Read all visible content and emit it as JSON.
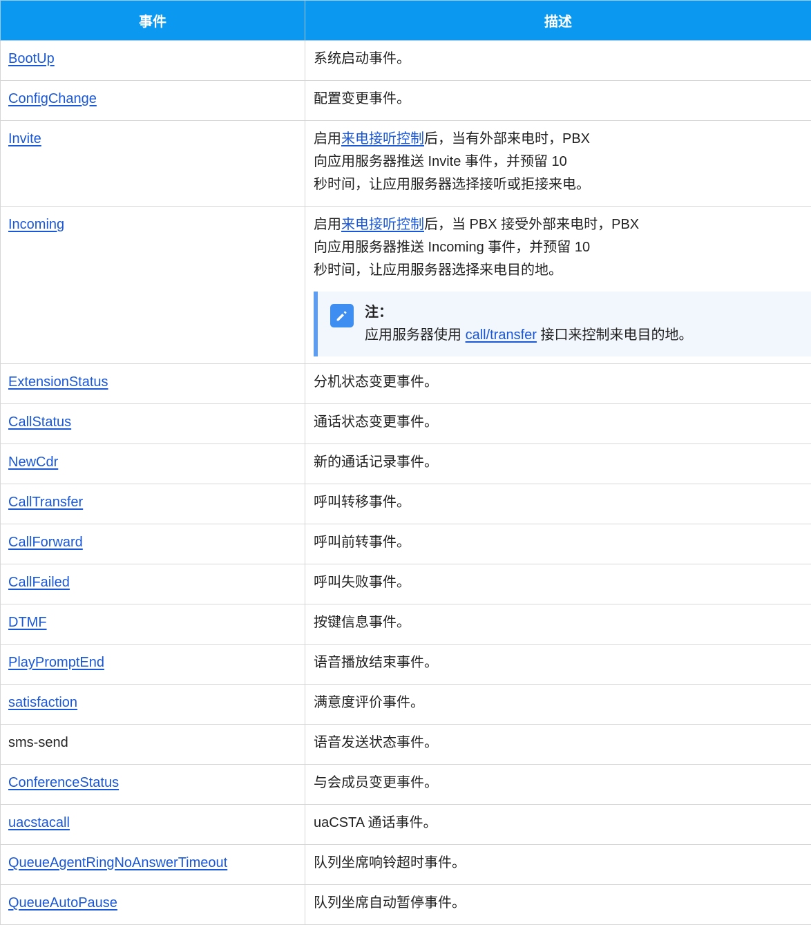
{
  "table": {
    "headers": [
      "事件",
      "描述"
    ],
    "rows": [
      {
        "event": "BootUp",
        "desc": "系统启动事件。"
      },
      {
        "event": "ConfigChange",
        "desc": "配置变更事件。"
      },
      {
        "event": "Invite",
        "desc_lines": [
          {
            "pre": "启用",
            "link": "来电接听控制",
            "post": "后，当有外部来电时，PBX"
          },
          "向应用服务器推送 Invite 事件，并预留 10",
          "秒时间，让应用服务器选择接听或拒接来电。"
        ]
      },
      {
        "event": "Incoming",
        "desc_lines": [
          {
            "pre": "启用",
            "link": "来电接听控制",
            "post": "后，当 PBX 接受外部来电时，PBX"
          },
          "向应用服务器推送 Incoming 事件，并预留 10",
          "秒时间，让应用服务器选择来电目的地。"
        ],
        "note": {
          "icon": "edit-icon",
          "title": "注：",
          "pre": "应用服务器使用 ",
          "link": "call/transfer",
          "post": " 接口来控制来电目的地。"
        }
      },
      {
        "event": "ExtensionStatus",
        "desc": "分机状态变更事件。"
      },
      {
        "event": "CallStatus",
        "desc": "通话状态变更事件。"
      },
      {
        "event": "NewCdr",
        "desc": "新的通话记录事件。"
      },
      {
        "event": "CallTransfer",
        "desc": "呼叫转移事件。"
      },
      {
        "event": "CallForward",
        "desc": "呼叫前转事件。"
      },
      {
        "event": "CallFailed",
        "desc": "呼叫失败事件。"
      },
      {
        "event": "DTMF",
        "desc": "按键信息事件。"
      },
      {
        "event": "PlayPromptEnd",
        "desc": "语音播放结束事件。"
      },
      {
        "event": "satisfaction",
        "desc": "满意度评价事件。"
      },
      {
        "event": "sms-send",
        "desc": "语音发送状态事件。",
        "plain": true
      },
      {
        "event": "ConferenceStatus",
        "desc": "与会成员变更事件。"
      },
      {
        "event": "uacstacall",
        "desc": "uaCSTA 通话事件。"
      },
      {
        "event": "QueueAgentRingNoAnswerTimeout",
        "desc": "队列坐席响铃超时事件。"
      },
      {
        "event": "QueueAutoPause",
        "desc": "队列坐席自动暂停事件。"
      }
    ]
  },
  "colors": {
    "header_bg": "#0a98f0",
    "link": "#1a57d6",
    "note_bar": "#5e9cf0",
    "note_bg": "#f2f7fd"
  }
}
